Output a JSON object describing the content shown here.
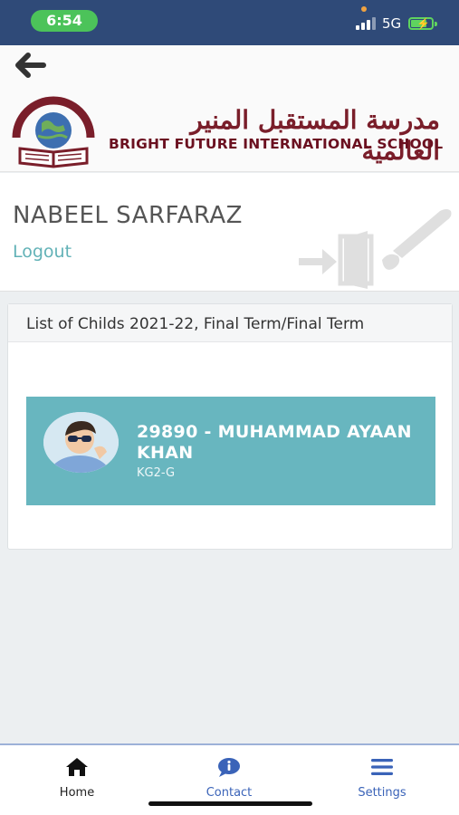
{
  "status_bar": {
    "time": "6:54",
    "network": "5G"
  },
  "header": {
    "school_name_ar": "مدرسة المستقبل المنير العالمية",
    "school_name_en": "BRIGHT FUTURE INTERNATIONAL SCHOOL"
  },
  "user": {
    "name": "NABEEL SARFARAZ",
    "logout_label": "Logout"
  },
  "card": {
    "title": "List of Childs 2021-22, Final Term/Final Term",
    "children": [
      {
        "name": "29890 - MUHAMMAD AYAAN KHAN",
        "class": "KG2-G"
      }
    ]
  },
  "bottom_nav": [
    {
      "label": "Home",
      "icon": "home-icon"
    },
    {
      "label": "Contact",
      "icon": "info-chat-icon"
    },
    {
      "label": "Settings",
      "icon": "menu-icon"
    }
  ],
  "colors": {
    "status_bar": "#2f4a78",
    "accent_teal": "#68b6bf",
    "logout": "#62b2b7",
    "nav_active": "#3a63b8",
    "brand_maroon": "#7a1e2a"
  }
}
